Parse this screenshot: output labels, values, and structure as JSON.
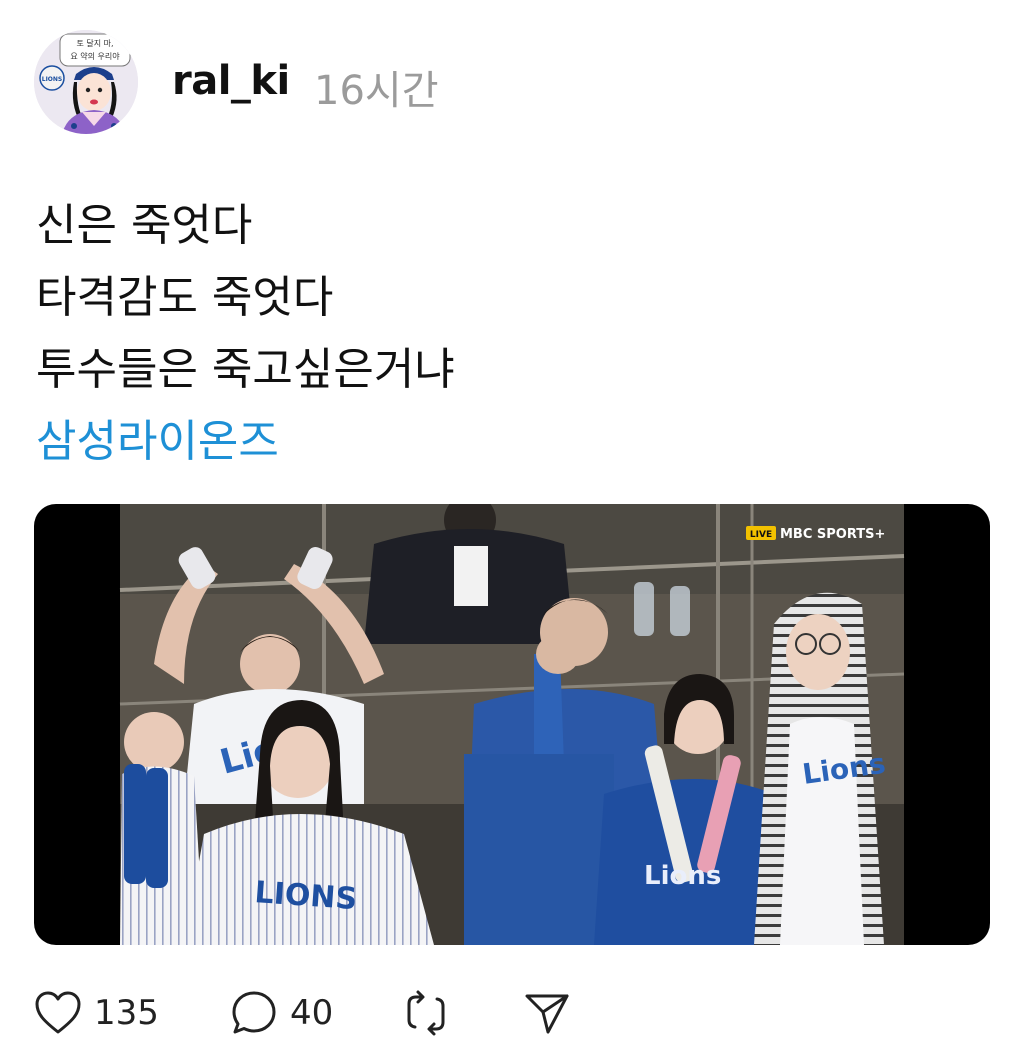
{
  "post": {
    "username": "ral_ki",
    "timestamp": "16시간",
    "avatar": {
      "icon": "avatar-illustration",
      "speech_line1": "토 달지 마,",
      "speech_line2": "요 약의 우리야",
      "badge": "LIONS"
    },
    "lines": [
      "신은 죽엇다",
      "타격감도 죽엇다",
      "투수들은 죽고싶은거냐"
    ],
    "hashtag": "삼성라이온즈",
    "video": {
      "broadcast_live": "LIVE",
      "broadcast_logo": "MBC SPORTS+",
      "jersey_text_1": "LIONS",
      "jersey_text_2": "Lions"
    }
  },
  "actions": {
    "like": {
      "icon": "heart-icon",
      "count": "135"
    },
    "reply": {
      "icon": "comment-icon",
      "count": "40"
    },
    "repost": {
      "icon": "repost-icon"
    },
    "share": {
      "icon": "send-icon"
    }
  },
  "colors": {
    "hashtag": "#1e90d6",
    "timestamp": "#9b9b9b",
    "text": "#111111"
  }
}
